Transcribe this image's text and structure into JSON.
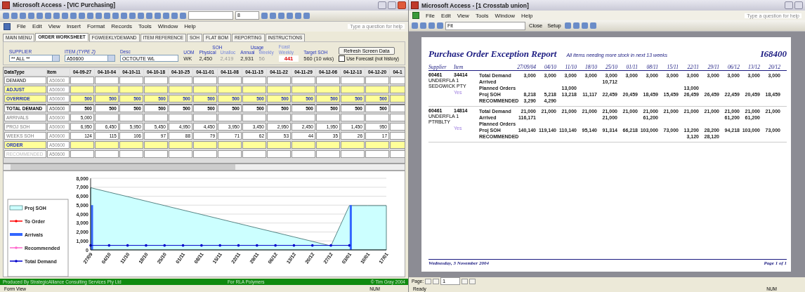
{
  "left_window": {
    "title": "Microsoft Access - [VIC Purchasing]",
    "font_size": "8",
    "menu": [
      "File",
      "Edit",
      "View",
      "Insert",
      "Format",
      "Records",
      "Tools",
      "Window",
      "Help"
    ],
    "help_placeholder": "Type a question for help",
    "tabs": [
      {
        "label": "MAIN MENU",
        "selected": false
      },
      {
        "label": "ORDER WORKSHEET",
        "selected": true
      },
      {
        "label": "FGWEEKLYDEMAND",
        "selected": false
      },
      {
        "label": "ITEM REFERENCE",
        "selected": false
      },
      {
        "label": "SOH",
        "selected": false
      },
      {
        "label": "FLAT BOM",
        "selected": false
      },
      {
        "label": "REPORTING",
        "selected": false
      },
      {
        "label": "INSTRUCTIONS",
        "selected": false
      }
    ],
    "form": {
      "supplier_label": "SUPPLIER",
      "supplier": "** ALL **",
      "item_label": "ITEM",
      "item_hint": "(TYPE 2)",
      "item": "A50600",
      "desc_label": "Desc",
      "desc": "OCTOUTE WL",
      "uom_label": "UOM",
      "uom": "WK",
      "soh_label": "SOH",
      "physical_label": "Physical",
      "physical": "2,450",
      "unalloc_label": "Unalloc",
      "unalloc": "2,419",
      "usage_label": "Usage",
      "annual_label": "Annual",
      "annual": "2,931",
      "weekly_label": "Weekly",
      "weekly": "56",
      "fcast_label": "Fcast",
      "fcast_weekly_label": "Weekly",
      "fcast": "441",
      "target_label": "Target SOH",
      "target": "560 (10 wks)",
      "refresh_button": "Refresh Screen Data",
      "use_forecast": {
        "label": "Use Forecast (not history)",
        "checked": false
      }
    },
    "grid": {
      "columns": [
        "DataType",
        "Item",
        "04-09-27",
        "04-10-04",
        "04-10-11",
        "04-10-18",
        "04-10-25",
        "04-11-01",
        "04-11-08",
        "04-11-15",
        "04-11-22",
        "04-11-29",
        "04-12-06",
        "04-12-13",
        "04-12-20",
        "04-1"
      ],
      "rows": [
        {
          "kind": "plain",
          "type": "DEMAND",
          "item": "A50600"
        },
        {
          "kind": "input",
          "type": "ADJUST",
          "item": "A50600"
        },
        {
          "kind": "input",
          "type": "OVERRIDE",
          "item": "A50600",
          "values": [
            "500",
            "500",
            "500",
            "500",
            "500",
            "500",
            "500",
            "500",
            "500",
            "500",
            "500",
            "500",
            "500"
          ]
        },
        {
          "kind": "total",
          "type": "TOTAL DEMAND",
          "item": "A50600",
          "values": [
            "500",
            "500",
            "500",
            "500",
            "500",
            "500",
            "500",
            "500",
            "500",
            "500",
            "500",
            "500",
            "500"
          ]
        },
        {
          "kind": "calc",
          "type": "ARRIVALS",
          "item": "A50600",
          "values": [
            "5,000"
          ]
        },
        {
          "kind": "calc",
          "type": "PROJ SOH",
          "item": "A50600",
          "values": [
            "6,950",
            "6,450",
            "5,950",
            "5,450",
            "4,950",
            "4,450",
            "3,950",
            "3,450",
            "2,950",
            "2,450",
            "1,950",
            "1,450",
            "950"
          ]
        },
        {
          "kind": "calc",
          "type": "WEEKS SOH",
          "item": "A50600",
          "values": [
            "124",
            "115",
            "106",
            "97",
            "88",
            "79",
            "71",
            "62",
            "53",
            "44",
            "35",
            "26",
            "17"
          ]
        },
        {
          "kind": "input",
          "type": "ORDER",
          "item": "A50600"
        },
        {
          "kind": "hint",
          "type": "RECOMMENDED",
          "item": "A50600"
        }
      ]
    },
    "chart_data": {
      "type": "area",
      "grid": true,
      "legend": "left",
      "categories": [
        "27/09",
        "04/10",
        "11/10",
        "18/10",
        "25/10",
        "01/11",
        "08/11",
        "15/11",
        "22/11",
        "29/11",
        "06/12",
        "13/12",
        "20/12",
        "27/12",
        "03/01",
        "10/01",
        "17/01"
      ],
      "ylim": [
        0,
        8000
      ],
      "yticks": [
        {
          "value": 0,
          "label": "0"
        },
        {
          "value": 1000,
          "label": "1,000"
        },
        {
          "value": 2000,
          "label": "2,000"
        },
        {
          "value": 3000,
          "label": "3,000"
        },
        {
          "value": 4000,
          "label": "4,000"
        },
        {
          "value": 5000,
          "label": "5,000"
        },
        {
          "value": 6000,
          "label": "6,000"
        },
        {
          "value": 7000,
          "label": "7,000"
        },
        {
          "value": 8000,
          "label": "8,000"
        }
      ],
      "series": [
        {
          "name": "Proj SOH",
          "color": "#ccffff",
          "values": [
            6950,
            6450,
            5950,
            5450,
            4950,
            4450,
            3950,
            3450,
            2950,
            2450,
            1950,
            1450,
            950,
            450,
            4950,
            4950,
            4950
          ]
        },
        {
          "name": "To Order",
          "type": "line",
          "color": "#ff0000",
          "values": [
            null,
            null,
            null,
            null,
            null,
            null,
            null,
            null,
            null,
            null,
            null,
            null,
            null,
            null,
            null,
            null,
            null
          ]
        },
        {
          "name": "Arrivals",
          "type": "bar",
          "color": "#3366ff",
          "values": [
            5000,
            0,
            0,
            0,
            0,
            0,
            0,
            0,
            0,
            0,
            0,
            0,
            0,
            0,
            5000,
            0,
            0
          ]
        },
        {
          "name": "Recommended",
          "type": "line",
          "color": "#ff66cc",
          "values": [
            null,
            null,
            null,
            null,
            null,
            null,
            null,
            null,
            null,
            null,
            null,
            null,
            null,
            null,
            null,
            null,
            null
          ]
        },
        {
          "name": "Total Demand",
          "type": "line",
          "color": "#0000cc",
          "values": [
            500,
            500,
            500,
            500,
            500,
            500,
            500,
            500,
            500,
            500,
            500,
            500,
            500,
            500,
            500,
            null,
            null
          ]
        }
      ]
    },
    "footer": [
      "Produced By StrategicAlliance Consulting Services Pty Ltd",
      "For RLA Polymers",
      "© Tim Gray 2004"
    ],
    "status": [
      "Form View",
      "NUM"
    ]
  },
  "right_window": {
    "title": "Microsoft Access - [1 Crosstab union]",
    "menu": [
      "File",
      "Edit",
      "View",
      "Tools",
      "Window",
      "Help"
    ],
    "help_placeholder": "Type a question for help",
    "zoom": "Fit",
    "close_button": "Close",
    "setup_button": "Setup",
    "report": {
      "title": "Purchase Order Exception Report",
      "subtitle": "All items needing more stock in next 13 weeks",
      "number": "I68400",
      "supplier_label": "Supplier",
      "item_label": "Item",
      "dates": [
        "27/09/04",
        "04/10",
        "11/10",
        "18/10",
        "25/10",
        "01/11",
        "08/11",
        "15/11",
        "22/11",
        "29/11",
        "06/12",
        "13/12",
        "20/12"
      ],
      "groups": [
        {
          "supplier": "60461",
          "item": "34414",
          "name": "UNDERFLA 1 SEDGWICK PTY",
          "note": "Yes",
          "rows": [
            {
              "label": "Total Demand",
              "values": [
                "3,000",
                "3,000",
                "3,000",
                "3,000",
                "3,000",
                "3,000",
                "3,000",
                "3,000",
                "3,000",
                "3,000",
                "3,000",
                "3,000",
                "3,000"
              ]
            },
            {
              "label": "Arrived",
              "cells": {
                "4": "10,712"
              }
            },
            {
              "label": "Planned Orders",
              "cells": {
                "2": "13,000",
                "8": "13,000"
              }
            },
            {
              "label": "Proj SOH",
              "values": [
                "8,218",
                "5,218",
                "13,218",
                "11,117",
                "22,459",
                "20,459",
                "18,459",
                "15,459",
                "26,459",
                "26,459",
                "22,459",
                "20,459",
                "18,459"
              ]
            },
            {
              "label": "RECOMMENDED",
              "values": [
                "3,290",
                "4,290"
              ]
            }
          ]
        },
        {
          "supplier": "60461",
          "item": "14814",
          "name": "UNDERFLA 1 PTRBLTY",
          "note": "Yes",
          "rows": [
            {
              "label": "Total Demand",
              "values": [
                "21,000",
                "21,000",
                "21,000",
                "21,000",
                "21,000",
                "21,000",
                "21,000",
                "21,000",
                "21,000",
                "21,000",
                "21,000",
                "21,000",
                "21,000"
              ]
            },
            {
              "label": "Arrived",
              "cells": {
                "0": "116,171",
                "4": "21,000",
                "6": "61,200",
                "10": "61,200",
                "11": "61,200"
              }
            },
            {
              "label": "Planned Orders"
            },
            {
              "label": "Proj SOH",
              "values": [
                "140,140",
                "119,140",
                "110,140",
                "95,140",
                "91,314",
                "66,218",
                "103,000",
                "73,000",
                "13,200",
                "28,200",
                "94,218",
                "103,000",
                "73,000"
              ]
            },
            {
              "label": "RECOMMENDED",
              "cells": {
                "8": "3,120",
                "9": "28,120"
              }
            }
          ]
        }
      ],
      "footer_date": "Wednesday, 3 November 2004",
      "footer_page": "Page 1 of 1"
    },
    "page_label": "Page:",
    "page": "1",
    "status": [
      "Ready",
      "NUM"
    ]
  }
}
